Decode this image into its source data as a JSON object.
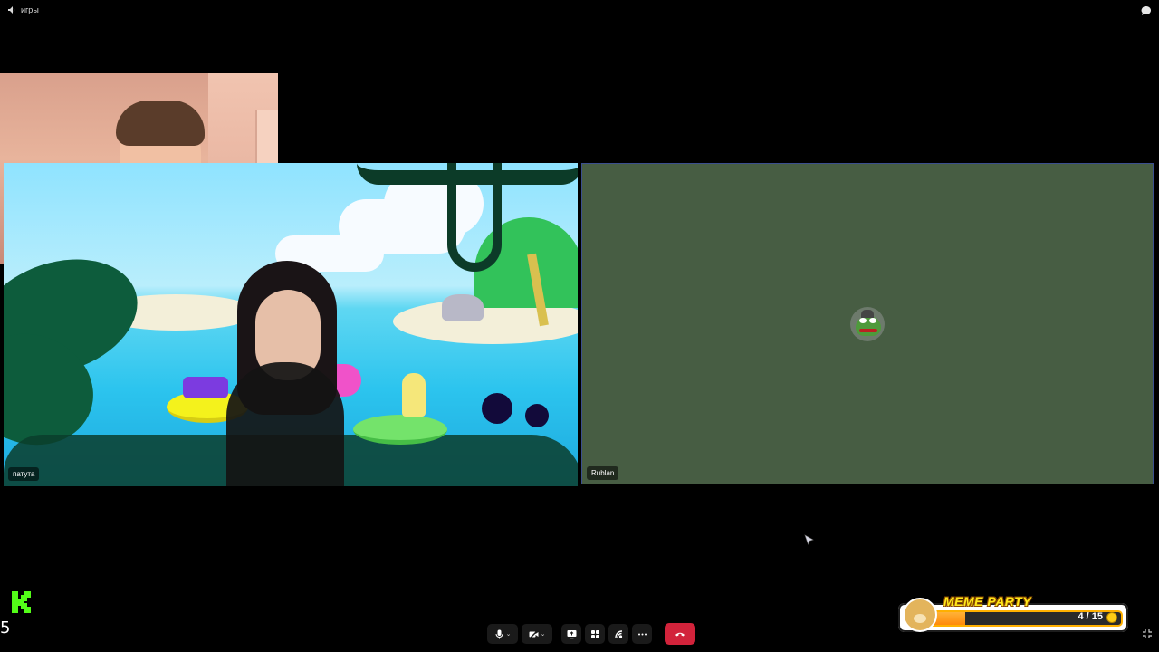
{
  "top_bar": {
    "channel_name": "игры"
  },
  "participants": [
    {
      "name": "патута"
    },
    {
      "name": "Rublan"
    }
  ],
  "bottom_left": {
    "counter": "5"
  },
  "meme_party": {
    "title": "MEME PARTY",
    "progress_text": "4 / 15",
    "progress_fraction": 0.27
  },
  "icons": {
    "channel": "speaker-icon",
    "chat": "chat-bubble-icon",
    "mic": "microphone-icon",
    "camera": "camera-off-icon",
    "screen": "screen-share-icon",
    "activities": "activities-icon",
    "soundboard": "soundboard-icon",
    "more": "more-icon",
    "leave": "hang-up-icon"
  },
  "colors": {
    "background": "#000000",
    "right_tile": "#475d43",
    "leave_button": "#d2233b",
    "kick_green": "#53fc18"
  }
}
